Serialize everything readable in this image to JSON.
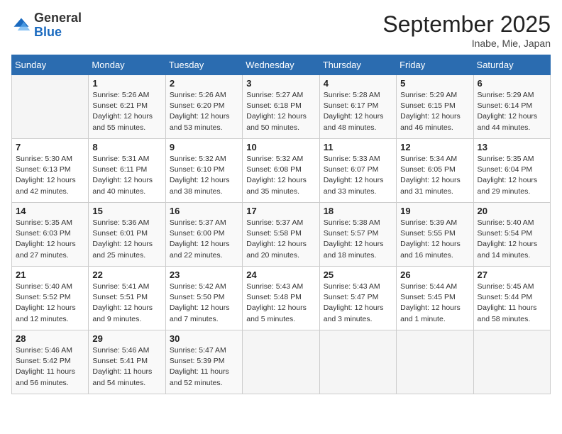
{
  "logo": {
    "general": "General",
    "blue": "Blue"
  },
  "title": "September 2025",
  "location": "Inabe, Mie, Japan",
  "days_of_week": [
    "Sunday",
    "Monday",
    "Tuesday",
    "Wednesday",
    "Thursday",
    "Friday",
    "Saturday"
  ],
  "weeks": [
    [
      {
        "day": "",
        "empty": true
      },
      {
        "day": "1",
        "sunrise": "5:26 AM",
        "sunset": "6:21 PM",
        "daylight": "12 hours and 55 minutes."
      },
      {
        "day": "2",
        "sunrise": "5:26 AM",
        "sunset": "6:20 PM",
        "daylight": "12 hours and 53 minutes."
      },
      {
        "day": "3",
        "sunrise": "5:27 AM",
        "sunset": "6:18 PM",
        "daylight": "12 hours and 50 minutes."
      },
      {
        "day": "4",
        "sunrise": "5:28 AM",
        "sunset": "6:17 PM",
        "daylight": "12 hours and 48 minutes."
      },
      {
        "day": "5",
        "sunrise": "5:29 AM",
        "sunset": "6:15 PM",
        "daylight": "12 hours and 46 minutes."
      },
      {
        "day": "6",
        "sunrise": "5:29 AM",
        "sunset": "6:14 PM",
        "daylight": "12 hours and 44 minutes."
      }
    ],
    [
      {
        "day": "7",
        "sunrise": "5:30 AM",
        "sunset": "6:13 PM",
        "daylight": "12 hours and 42 minutes."
      },
      {
        "day": "8",
        "sunrise": "5:31 AM",
        "sunset": "6:11 PM",
        "daylight": "12 hours and 40 minutes."
      },
      {
        "day": "9",
        "sunrise": "5:32 AM",
        "sunset": "6:10 PM",
        "daylight": "12 hours and 38 minutes."
      },
      {
        "day": "10",
        "sunrise": "5:32 AM",
        "sunset": "6:08 PM",
        "daylight": "12 hours and 35 minutes."
      },
      {
        "day": "11",
        "sunrise": "5:33 AM",
        "sunset": "6:07 PM",
        "daylight": "12 hours and 33 minutes."
      },
      {
        "day": "12",
        "sunrise": "5:34 AM",
        "sunset": "6:05 PM",
        "daylight": "12 hours and 31 minutes."
      },
      {
        "day": "13",
        "sunrise": "5:35 AM",
        "sunset": "6:04 PM",
        "daylight": "12 hours and 29 minutes."
      }
    ],
    [
      {
        "day": "14",
        "sunrise": "5:35 AM",
        "sunset": "6:03 PM",
        "daylight": "12 hours and 27 minutes."
      },
      {
        "day": "15",
        "sunrise": "5:36 AM",
        "sunset": "6:01 PM",
        "daylight": "12 hours and 25 minutes."
      },
      {
        "day": "16",
        "sunrise": "5:37 AM",
        "sunset": "6:00 PM",
        "daylight": "12 hours and 22 minutes."
      },
      {
        "day": "17",
        "sunrise": "5:37 AM",
        "sunset": "5:58 PM",
        "daylight": "12 hours and 20 minutes."
      },
      {
        "day": "18",
        "sunrise": "5:38 AM",
        "sunset": "5:57 PM",
        "daylight": "12 hours and 18 minutes."
      },
      {
        "day": "19",
        "sunrise": "5:39 AM",
        "sunset": "5:55 PM",
        "daylight": "12 hours and 16 minutes."
      },
      {
        "day": "20",
        "sunrise": "5:40 AM",
        "sunset": "5:54 PM",
        "daylight": "12 hours and 14 minutes."
      }
    ],
    [
      {
        "day": "21",
        "sunrise": "5:40 AM",
        "sunset": "5:52 PM",
        "daylight": "12 hours and 12 minutes."
      },
      {
        "day": "22",
        "sunrise": "5:41 AM",
        "sunset": "5:51 PM",
        "daylight": "12 hours and 9 minutes."
      },
      {
        "day": "23",
        "sunrise": "5:42 AM",
        "sunset": "5:50 PM",
        "daylight": "12 hours and 7 minutes."
      },
      {
        "day": "24",
        "sunrise": "5:43 AM",
        "sunset": "5:48 PM",
        "daylight": "12 hours and 5 minutes."
      },
      {
        "day": "25",
        "sunrise": "5:43 AM",
        "sunset": "5:47 PM",
        "daylight": "12 hours and 3 minutes."
      },
      {
        "day": "26",
        "sunrise": "5:44 AM",
        "sunset": "5:45 PM",
        "daylight": "12 hours and 1 minute."
      },
      {
        "day": "27",
        "sunrise": "5:45 AM",
        "sunset": "5:44 PM",
        "daylight": "11 hours and 58 minutes."
      }
    ],
    [
      {
        "day": "28",
        "sunrise": "5:46 AM",
        "sunset": "5:42 PM",
        "daylight": "11 hours and 56 minutes."
      },
      {
        "day": "29",
        "sunrise": "5:46 AM",
        "sunset": "5:41 PM",
        "daylight": "11 hours and 54 minutes."
      },
      {
        "day": "30",
        "sunrise": "5:47 AM",
        "sunset": "5:39 PM",
        "daylight": "11 hours and 52 minutes."
      },
      {
        "day": "",
        "empty": true
      },
      {
        "day": "",
        "empty": true
      },
      {
        "day": "",
        "empty": true
      },
      {
        "day": "",
        "empty": true
      }
    ]
  ]
}
